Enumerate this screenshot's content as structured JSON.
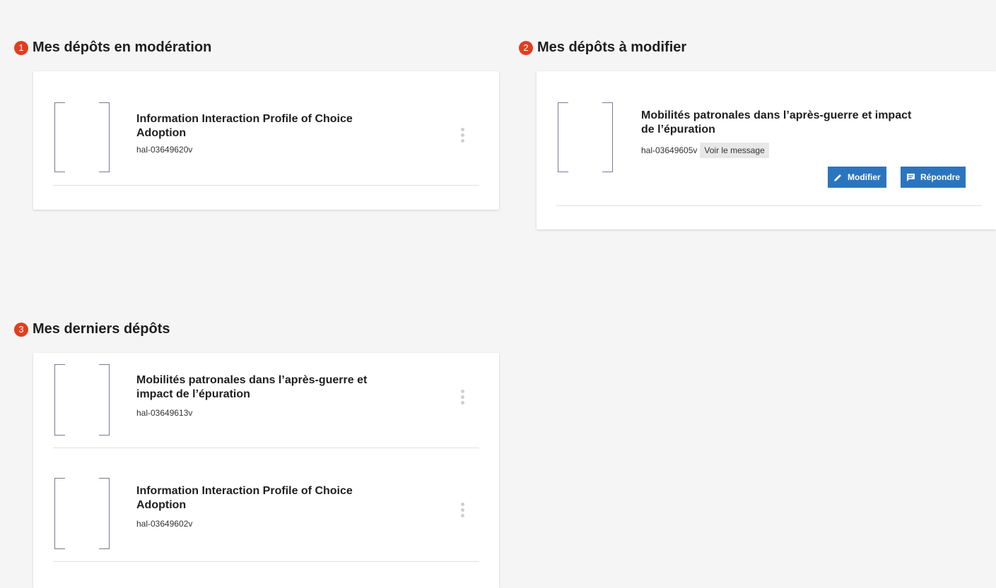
{
  "sections": {
    "moderation": {
      "badge": "1",
      "title": "Mes dépôts en modération",
      "items": [
        {
          "title_line1": "Information Interaction Profile of Choice",
          "title_line2": "Adoption",
          "id": "hal-03649620v"
        }
      ]
    },
    "to_modify": {
      "badge": "2",
      "title": "Mes dépôts à modifier",
      "items": [
        {
          "title_line1": "Mobilités patronales dans l’après-guerre et impact",
          "title_line2": "de l’épuration",
          "id": "hal-03649605v",
          "message_label": "Voir le message",
          "modify_label": "Modifier",
          "reply_label": "Répondre"
        }
      ]
    },
    "latest": {
      "badge": "3",
      "title": "Mes derniers dépôts",
      "items": [
        {
          "title_line1": "Mobilités patronales dans l’après-guerre et",
          "title_line2": "impact de l’épuration",
          "id": "hal-03649613v"
        },
        {
          "title_line1": "Information Interaction Profile of Choice",
          "title_line2": "Adoption",
          "id": "hal-03649602v"
        }
      ]
    }
  },
  "colors": {
    "badge": "#e03e1f",
    "button": "#2b75c0",
    "bracket": "#7b7891"
  },
  "icons": {
    "more": "kebab-menu-icon",
    "edit": "pencil-icon",
    "reply": "message-icon"
  }
}
